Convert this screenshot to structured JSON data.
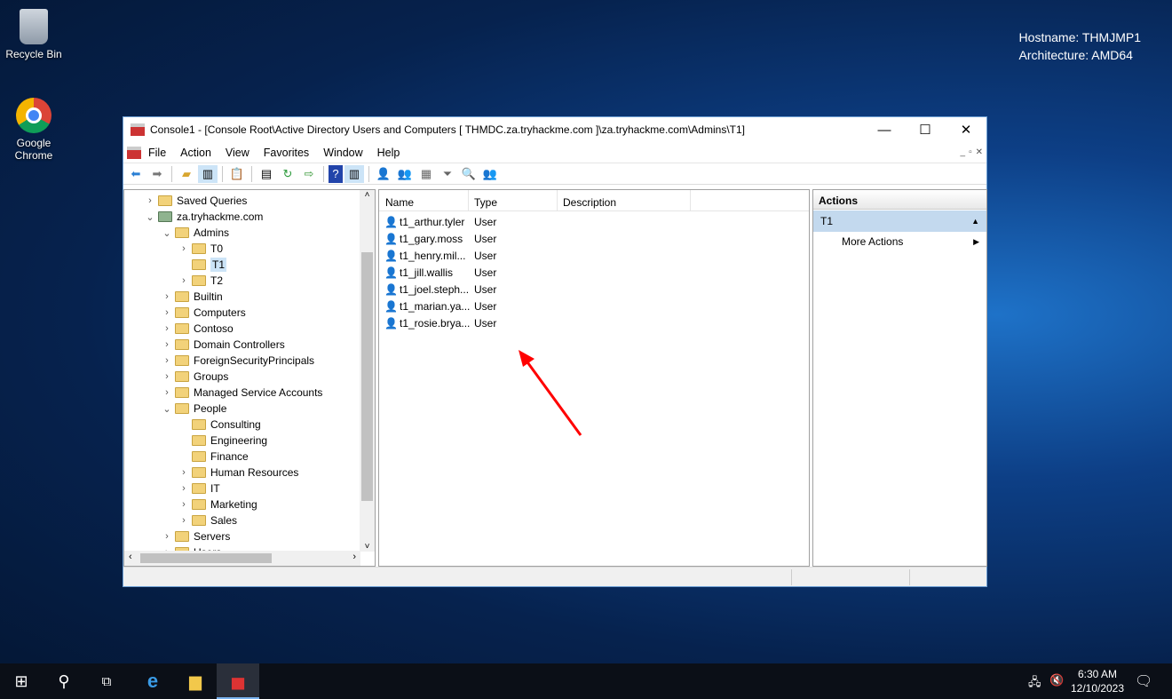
{
  "desktop": {
    "icons": [
      {
        "label": "Recycle Bin",
        "icon": "recycle-bin-icon"
      },
      {
        "label": "Google Chrome",
        "icon": "chrome-icon"
      }
    ],
    "hostname": "Hostname: THMJMP1",
    "architecture": "Architecture: AMD64"
  },
  "window": {
    "title": "Console1 - [Console Root\\Active Directory Users and Computers [ THMDC.za.tryhackme.com ]\\za.tryhackme.com\\Admins\\T1]",
    "menu": [
      "File",
      "Action",
      "View",
      "Favorites",
      "Window",
      "Help"
    ],
    "tree": [
      {
        "label": "Saved Queries",
        "level": 0,
        "arrow": ">"
      },
      {
        "label": "za.tryhackme.com",
        "level": 0,
        "arrow": "v",
        "domain": true
      },
      {
        "label": "Admins",
        "level": 1,
        "arrow": "v"
      },
      {
        "label": "T0",
        "level": 2,
        "arrow": ">"
      },
      {
        "label": "T1",
        "level": 2,
        "arrow": "",
        "selected": true
      },
      {
        "label": "T2",
        "level": 2,
        "arrow": ">"
      },
      {
        "label": "Builtin",
        "level": 1,
        "arrow": ">"
      },
      {
        "label": "Computers",
        "level": 1,
        "arrow": ">"
      },
      {
        "label": "Contoso",
        "level": 1,
        "arrow": ">"
      },
      {
        "label": "Domain Controllers",
        "level": 1,
        "arrow": ">"
      },
      {
        "label": "ForeignSecurityPrincipals",
        "level": 1,
        "arrow": ">"
      },
      {
        "label": "Groups",
        "level": 1,
        "arrow": ">"
      },
      {
        "label": "Managed Service Accounts",
        "level": 1,
        "arrow": ">"
      },
      {
        "label": "People",
        "level": 1,
        "arrow": "v"
      },
      {
        "label": "Consulting",
        "level": 2,
        "arrow": ""
      },
      {
        "label": "Engineering",
        "level": 2,
        "arrow": ""
      },
      {
        "label": "Finance",
        "level": 2,
        "arrow": ""
      },
      {
        "label": "Human Resources",
        "level": 2,
        "arrow": ">"
      },
      {
        "label": "IT",
        "level": 2,
        "arrow": ">"
      },
      {
        "label": "Marketing",
        "level": 2,
        "arrow": ">"
      },
      {
        "label": "Sales",
        "level": 2,
        "arrow": ">"
      },
      {
        "label": "Servers",
        "level": 1,
        "arrow": ">"
      },
      {
        "label": "Users",
        "level": 1,
        "arrow": ">"
      }
    ],
    "columns": [
      "Name",
      "Type",
      "Description"
    ],
    "rows": [
      {
        "name": "t1_arthur.tyler",
        "type": "User"
      },
      {
        "name": "t1_gary.moss",
        "type": "User"
      },
      {
        "name": "t1_henry.mil...",
        "type": "User"
      },
      {
        "name": "t1_jill.wallis",
        "type": "User"
      },
      {
        "name": "t1_joel.steph...",
        "type": "User"
      },
      {
        "name": "t1_marian.ya...",
        "type": "User"
      },
      {
        "name": "t1_rosie.brya...",
        "type": "User"
      }
    ],
    "actions": {
      "header": "Actions",
      "section": "T1",
      "item": "More Actions"
    }
  },
  "taskbar": {
    "time": "6:30 AM",
    "date": "12/10/2023"
  },
  "colors": {
    "arrow": "#ff0000",
    "selection": "#cce4f7"
  }
}
